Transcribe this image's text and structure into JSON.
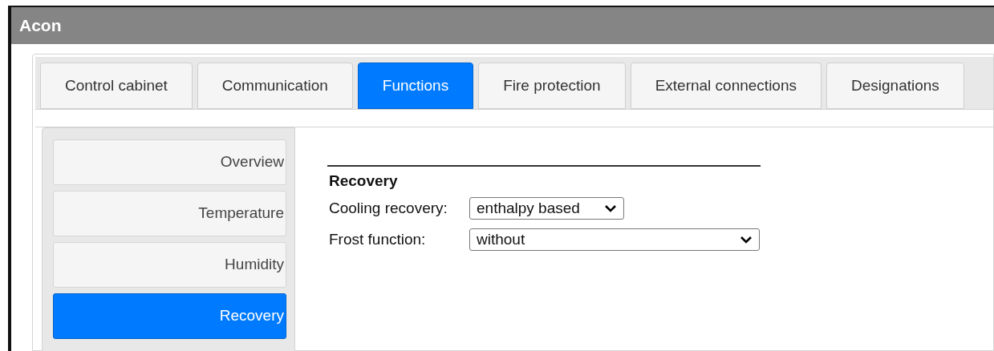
{
  "window": {
    "title": "Acon"
  },
  "tabs": [
    {
      "label": "Control cabinet",
      "selected": false
    },
    {
      "label": "Communication",
      "selected": false
    },
    {
      "label": "Functions",
      "selected": true
    },
    {
      "label": "Fire protection",
      "selected": false
    },
    {
      "label": "External connections",
      "selected": false
    },
    {
      "label": "Designations",
      "selected": false
    }
  ],
  "sidebar": {
    "items": [
      {
        "label": "Overview",
        "selected": false
      },
      {
        "label": "Temperature",
        "selected": false
      },
      {
        "label": "Humidity",
        "selected": false
      },
      {
        "label": "Recovery",
        "selected": true
      }
    ]
  },
  "section": {
    "title": "Recovery",
    "fields": [
      {
        "label": "Cooling recovery:",
        "value": "enthalpy based",
        "wide": false
      },
      {
        "label": "Frost function:",
        "value": "without",
        "wide": true
      }
    ]
  }
}
